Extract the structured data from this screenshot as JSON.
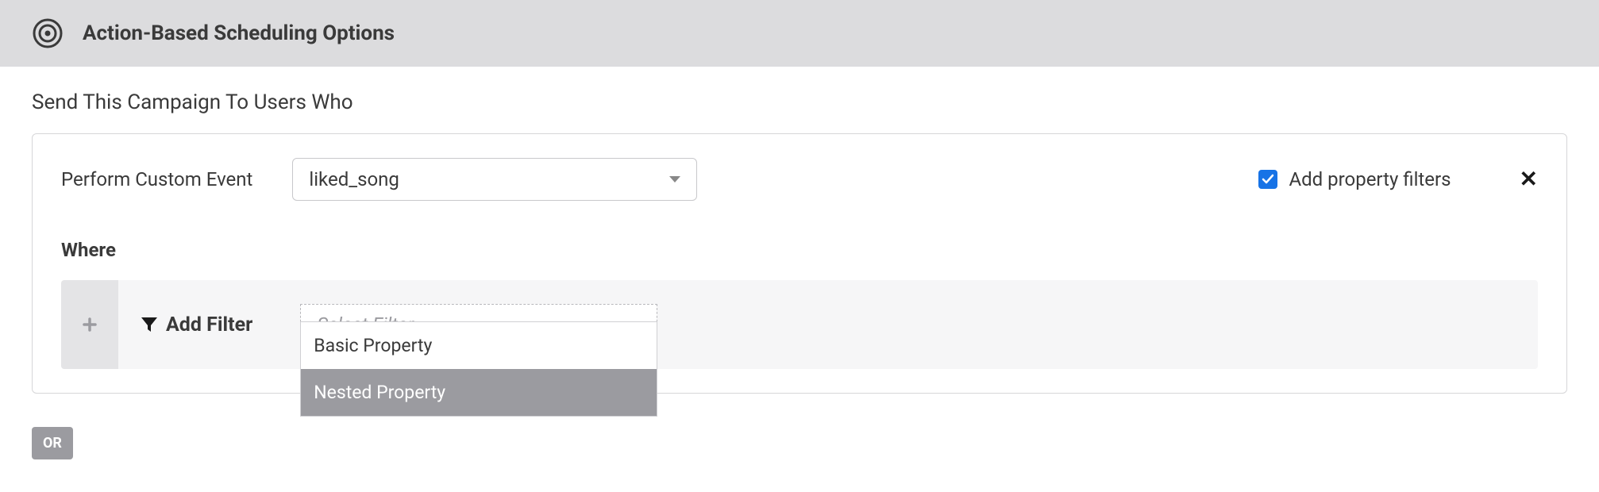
{
  "header": {
    "title": "Action-Based Scheduling Options"
  },
  "subtitle": "Send This Campaign To Users Who",
  "event": {
    "label": "Perform Custom Event",
    "selected": "liked_song"
  },
  "propertyFilters": {
    "checkboxLabel": "Add property filters",
    "checked": true
  },
  "where": {
    "label": "Where",
    "addFilterLabel": "Add Filter",
    "filterPlaceholder": "Select Filter...",
    "options": [
      {
        "label": "Basic Property",
        "highlighted": false
      },
      {
        "label": "Nested Property",
        "highlighted": true
      }
    ]
  },
  "orLabel": "OR"
}
